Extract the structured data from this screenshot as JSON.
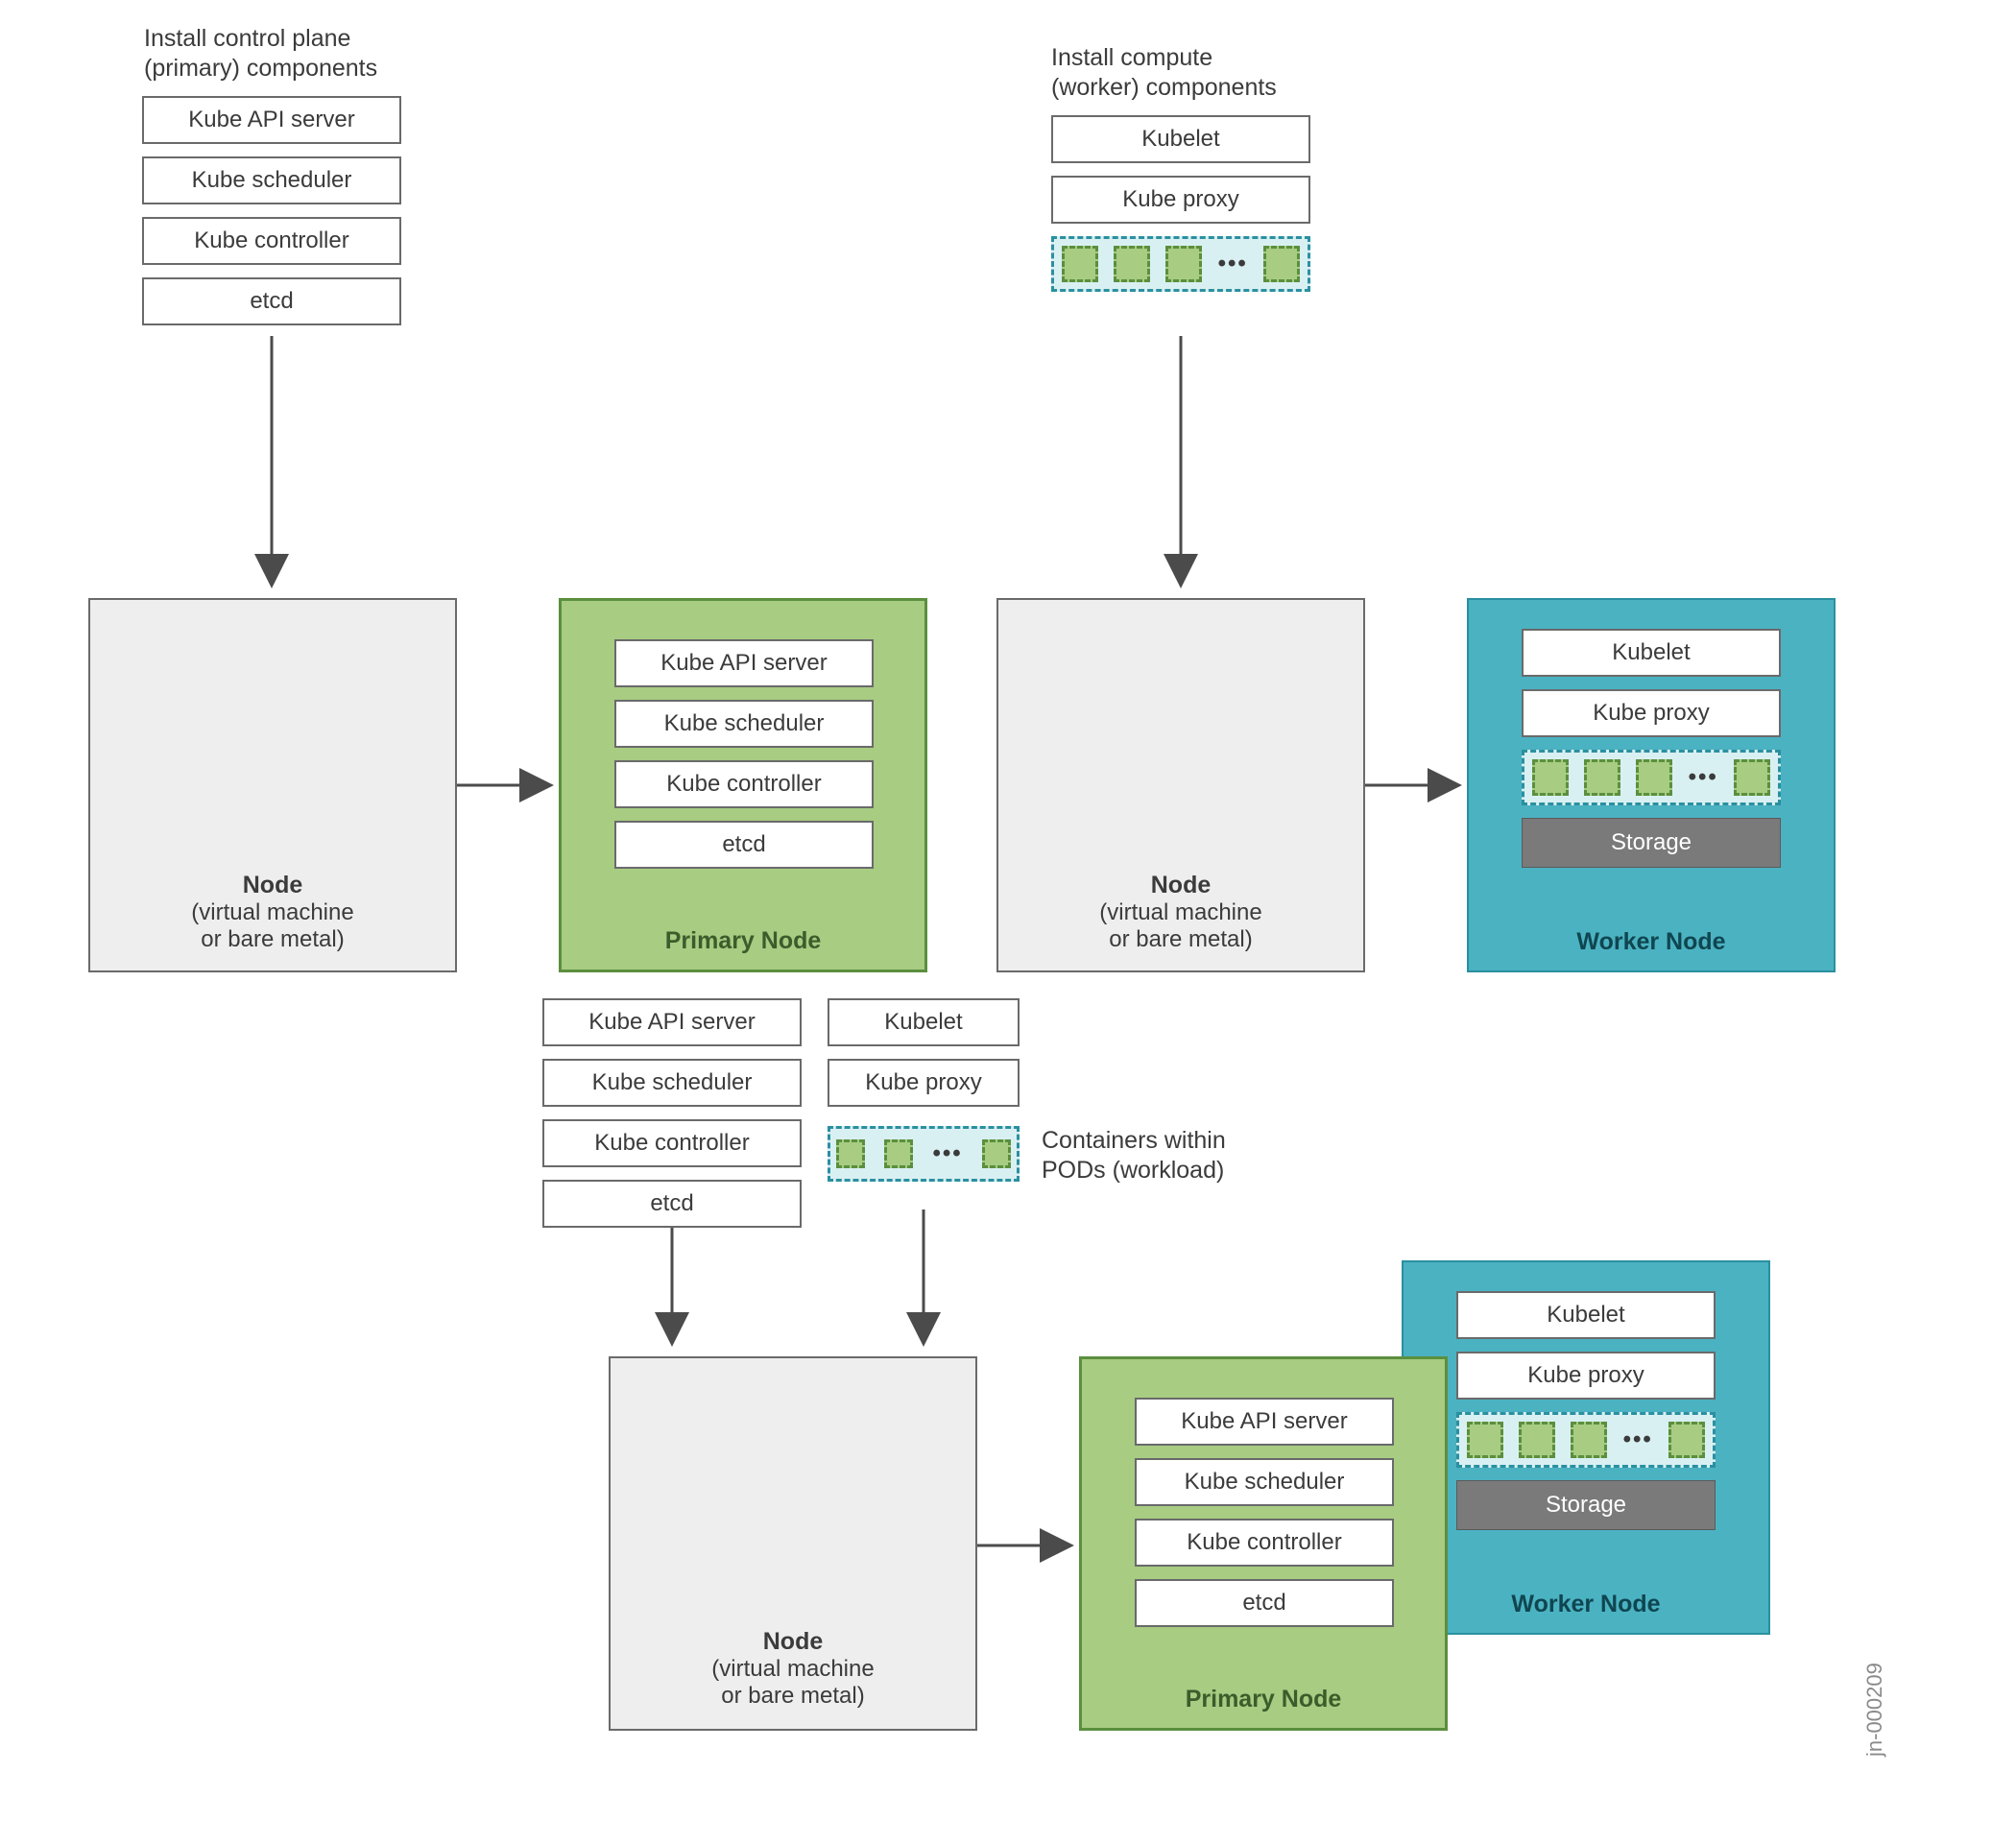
{
  "labels": {
    "install_control_plane_1": "Install control plane",
    "install_control_plane_2": "(primary) components",
    "install_compute_1": "Install compute",
    "install_compute_2": "(worker) components",
    "node_title": "Node",
    "node_sub_1": "(virtual machine",
    "node_sub_2": "or bare metal)",
    "primary_node": "Primary Node",
    "worker_node": "Worker Node",
    "storage": "Storage",
    "pods_label_1": "Containers within",
    "pods_label_2": "PODs (workload)",
    "image_id": "jn-000209"
  },
  "components": {
    "kube_api_server": "Kube API server",
    "kube_scheduler": "Kube scheduler",
    "kube_controller": "Kube controller",
    "etcd": "etcd",
    "kubelet": "Kubelet",
    "kube_proxy": "Kube proxy"
  },
  "colors": {
    "node_bg": "#eeeeee",
    "node_border": "#6a6a6a",
    "primary_bg": "#a7cc82",
    "primary_border": "#5b8f3e",
    "worker_bg": "#4bb2c2",
    "worker_border": "#2a90a0",
    "storage_bg": "#7a7a7a",
    "text": "#3b3b3b",
    "muted": "#8a8a8a"
  }
}
